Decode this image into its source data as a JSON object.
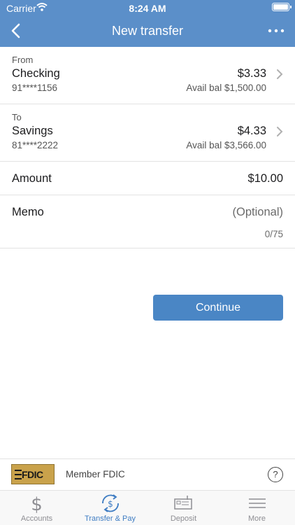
{
  "status_bar": {
    "carrier": "Carrier",
    "time": "8:24 AM"
  },
  "nav": {
    "title": "New transfer"
  },
  "from": {
    "label": "From",
    "account_name": "Checking",
    "account_number": "91****1156",
    "balance": "$3.33",
    "available": "Avail bal $1,500.00"
  },
  "to": {
    "label": "To",
    "account_name": "Savings",
    "account_number": "81****2222",
    "balance": "$4.33",
    "available": "Avail bal $3,566.00"
  },
  "amount": {
    "label": "Amount",
    "value": "$10.00"
  },
  "memo": {
    "label": "Memo",
    "placeholder": "(Optional)",
    "char_count": "0/75"
  },
  "continue_label": "Continue",
  "fdic": {
    "logo_text": "FDIC",
    "member_text": "Member FDIC",
    "help_glyph": "?"
  },
  "tabs": [
    {
      "label": "Accounts",
      "icon": "dollar-icon"
    },
    {
      "label": "Transfer & Pay",
      "icon": "transfer-icon"
    },
    {
      "label": "Deposit",
      "icon": "check-deposit-icon"
    },
    {
      "label": "More",
      "icon": "menu-icon"
    }
  ],
  "colors": {
    "header": "#5b8fc9",
    "accent": "#4a86c5",
    "active_tab": "#3f7dc3",
    "inactive_tab": "#8e8e93"
  }
}
